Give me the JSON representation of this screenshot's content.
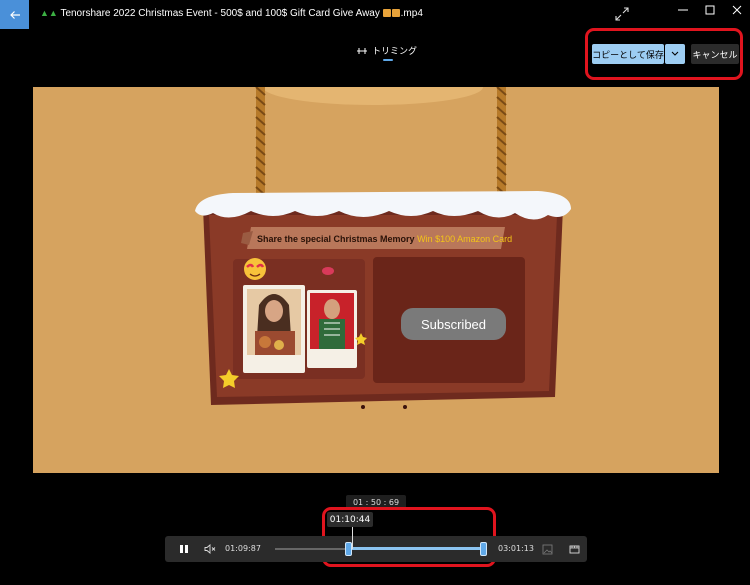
{
  "window": {
    "title_text": "Tenorshare 2022 Christmas Event - 500$ and 100$ Gift Card Give Away",
    "title_ext": ".mp4"
  },
  "mode": {
    "label": "トリミング"
  },
  "actions": {
    "save_label": "コピーとして保存",
    "cancel_label": "キャンセル"
  },
  "video": {
    "banner_main": "Share the special Christmas Memory",
    "banner_highlight": "Win $100 Amazon Card",
    "overlay_button": "Subscribed"
  },
  "playback": {
    "hover_time": "01 : 50 : 69",
    "playhead_time": "01:10:44",
    "trim_start": "01:09:87",
    "trim_end": "03:01:13"
  },
  "colors": {
    "accent": "#9dcdf2",
    "highlight_box": "#e0141e",
    "video_bg": "#d6a35f"
  }
}
